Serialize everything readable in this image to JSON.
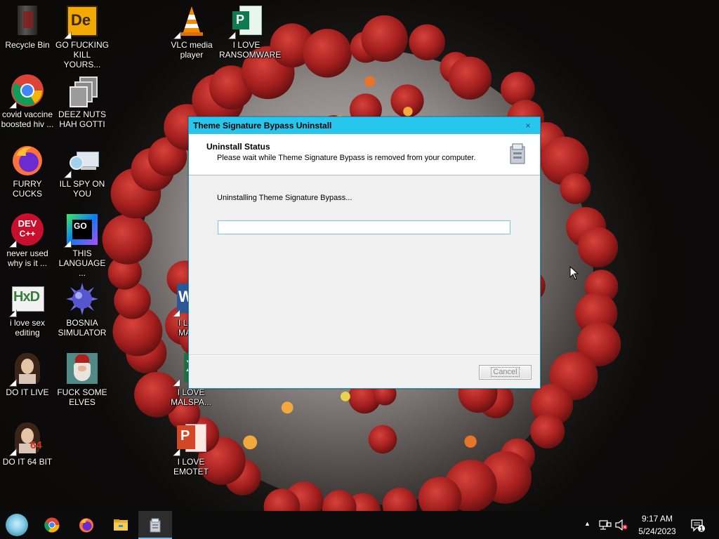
{
  "desktop": {
    "icons": [
      {
        "label": "Recycle Bin"
      },
      {
        "label": "GO FUCKING KILL YOURS..."
      },
      {
        "label": "VLC media player"
      },
      {
        "label": "I LOVE RANSOMWARE"
      },
      {
        "label": "covid vaccine boosted hiv ..."
      },
      {
        "label": "DEEZ NUTS HAH GOTTI"
      },
      {
        "label": "FURRY CUCKS"
      },
      {
        "label": "ILL SPY ON YOU"
      },
      {
        "label": "never used why is it ..."
      },
      {
        "label": "THIS LANGUAGE ..."
      },
      {
        "label": "i love sex editing"
      },
      {
        "label": "BOSNIA SIMULATOR"
      },
      {
        "label": "DO IT LIVE"
      },
      {
        "label": "FUCK SOME ELVES"
      },
      {
        "label": "DO IT 64 BIT"
      },
      {
        "label": "I L MAL"
      },
      {
        "label": "I LOVE MALSPA..."
      },
      {
        "label": "I LOVE EMOTET"
      }
    ],
    "icon_glyphs": {
      "de": "De",
      "dev": "DEV",
      "cpp": "C++",
      "go": "GO",
      "hxd": "HxD",
      "w": "W",
      "x": "X",
      "p": "P",
      "p2": "P",
      "b64": "64"
    }
  },
  "dialog": {
    "title": "Theme Signature Bypass Uninstall",
    "close": "×",
    "header_title": "Uninstall Status",
    "header_subtitle": "Please wait while Theme Signature Bypass is removed from your computer.",
    "status": "Uninstalling Theme Signature Bypass...",
    "progress_percent": 0,
    "cancel_label": "Cancel"
  },
  "taskbar": {
    "apps": [
      "start",
      "chrome",
      "firefox",
      "file-explorer",
      "uninstaller"
    ],
    "tray_chevron": "▲",
    "time": "9:17 AM",
    "date": "5/24/2023",
    "notification_count": "1"
  },
  "colors": {
    "titlebar": "#27c6ec",
    "progress_border": "#7ec7d8",
    "taskbar": "#0b0b0b"
  }
}
